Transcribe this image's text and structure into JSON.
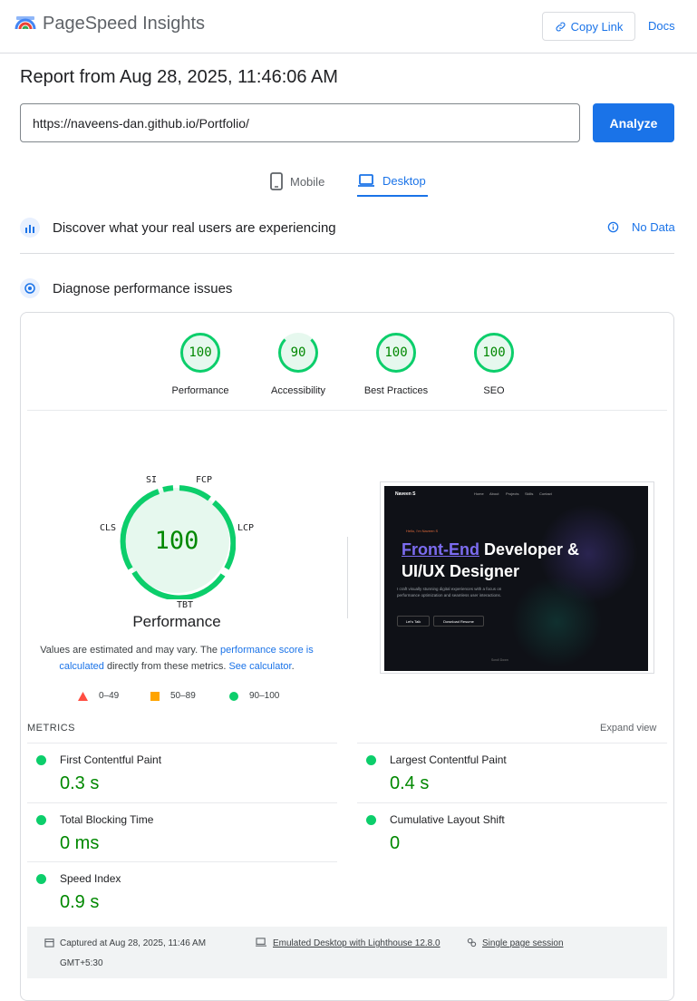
{
  "header": {
    "brand": "PageSpeed Insights",
    "copy_link": "Copy Link",
    "docs": "Docs"
  },
  "report": {
    "title": "Report from Aug 28, 2025, 11:46:06 AM",
    "url": "https://naveens-dan.github.io/Portfolio/",
    "analyze": "Analyze"
  },
  "tabs": [
    {
      "label": "Mobile",
      "active": false
    },
    {
      "label": "Desktop",
      "active": true
    }
  ],
  "real_users": {
    "title": "Discover what your real users are experiencing",
    "no_data": "No Data"
  },
  "diagnose": {
    "title": "Diagnose performance issues"
  },
  "scores": [
    {
      "label": "Performance",
      "value": "100"
    },
    {
      "label": "Accessibility",
      "value": "90"
    },
    {
      "label": "Best Practices",
      "value": "100"
    },
    {
      "label": "SEO",
      "value": "100"
    }
  ],
  "perf_gauge": {
    "score": "100",
    "label": "Performance",
    "metric_labels": {
      "si": "SI",
      "fcp": "FCP",
      "lcp": "LCP",
      "tbt": "TBT",
      "cls": "CLS"
    }
  },
  "note": {
    "text1": "Values are estimated and may vary. The ",
    "link1": "performance score is calculated",
    "text2": " directly from these metrics. ",
    "link2": "See calculator",
    "text3": "."
  },
  "legend": [
    {
      "range": "0–49",
      "color": "#ff4e42"
    },
    {
      "range": "50–89",
      "color": "#ffa400"
    },
    {
      "range": "90–100",
      "color": "#0cce6b"
    }
  ],
  "screenshot": {
    "brand": "Naveen S",
    "nav": [
      "Home",
      "About",
      "Projects",
      "Skills",
      "Contact"
    ],
    "eyebrow": "Hello, I'm Naveen S",
    "headline_accent": "Front-End",
    "headline_rest1": " Developer &",
    "headline_rest2": "UI/UX Designer",
    "desc": "I craft visually stunning digital experiences with a focus on performance optimization and seamless user interactions.",
    "btn1": "Let's Talk",
    "btn2": "Download Resume",
    "scroll": "Scroll Down"
  },
  "metrics": {
    "header": "METRICS",
    "expand": "Expand view",
    "items": [
      {
        "name": "First Contentful Paint",
        "value": "0.3 s"
      },
      {
        "name": "Largest Contentful Paint",
        "value": "0.4 s"
      },
      {
        "name": "Total Blocking Time",
        "value": "0 ms"
      },
      {
        "name": "Cumulative Layout Shift",
        "value": "0"
      },
      {
        "name": "Speed Index",
        "value": "0.9 s"
      }
    ]
  },
  "footer": {
    "captured": "Captured at Aug 28, 2025, 11:46 AM",
    "tz": "GMT+5:30",
    "emulated": "Emulated Desktop with Lighthouse 12.8.0",
    "session": "Single page session"
  },
  "colors": {
    "accent": "#1a73e8",
    "pass": "#0cce6b",
    "pass_text": "#008800"
  }
}
